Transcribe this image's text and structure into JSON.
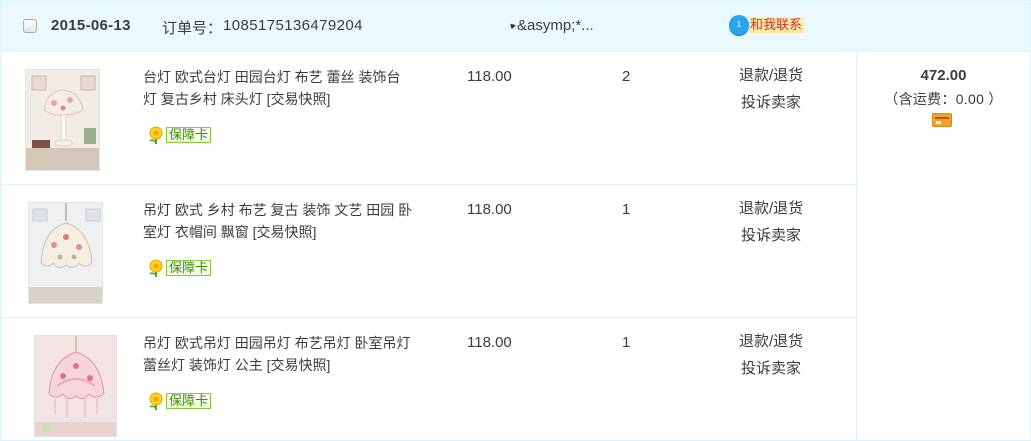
{
  "order": {
    "date": "2015-06-13",
    "order_label": "订单号：",
    "order_number": "1085175136479204",
    "shop_name": "&asymp;*...",
    "contact_label": "和我联系",
    "contact_badge": "1",
    "total": "472.00",
    "shipping": "（含运费：0.00 ）"
  },
  "items": [
    {
      "title": "台灯 欧式台灯 田园台灯 布艺 蕾丝 装饰台灯 复古乡村 床头灯 [交易快照]",
      "price": "118.00",
      "quantity": "2",
      "action_refund": "退款/退货",
      "action_complain": "投诉卖家",
      "badge": "保障卡"
    },
    {
      "title": "吊灯 欧式 乡村 布艺 复古 装饰 文艺 田园 卧室灯 衣帽间 飘窗 [交易快照]",
      "price": "118.00",
      "quantity": "1",
      "action_refund": "退款/退货",
      "action_complain": "投诉卖家",
      "badge": "保障卡"
    },
    {
      "title": "吊灯 欧式吊灯 田园吊灯 布艺吊灯 卧室吊灯 蕾丝灯 装饰灯 公主 [交易快照]",
      "price": "118.00",
      "quantity": "1",
      "action_refund": "退款/退货",
      "action_complain": "投诉卖家",
      "badge": "保障卡"
    }
  ],
  "colors": {
    "header_bg": "#eaf8ff",
    "border": "#daf3ff",
    "contact_bg": "#ffe9a6",
    "contact_text": "#cc3333",
    "badge_green": "#3a8f00",
    "bubble_blue": "#2ba4f0"
  },
  "icons": {
    "checkbox": "checkbox-icon",
    "shop": "shop-arrow-icon",
    "contact": "chat-bubble-icon",
    "badge": "shield-flower-icon",
    "payment": "credit-card-icon"
  }
}
